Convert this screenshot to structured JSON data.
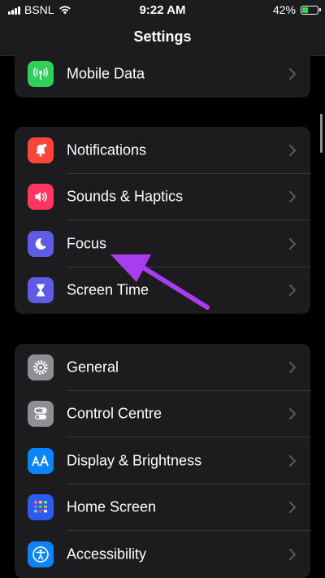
{
  "status_bar": {
    "carrier": "BSNL",
    "time": "9:22 AM",
    "battery": "42%",
    "battery_level": 0.42
  },
  "nav": {
    "title": "Settings"
  },
  "groups": [
    {
      "items": [
        {
          "label": "Mobile Data",
          "icon": "antenna-icon",
          "color": "#30d158"
        }
      ]
    },
    {
      "items": [
        {
          "label": "Notifications",
          "icon": "bell-icon",
          "color": "#ff453a"
        },
        {
          "label": "Sounds & Haptics",
          "icon": "speaker-icon",
          "color": "#ff375f"
        },
        {
          "label": "Focus",
          "icon": "moon-icon",
          "color": "#5e5ce6"
        },
        {
          "label": "Screen Time",
          "icon": "hourglass-icon",
          "color": "#5e5ce6"
        }
      ]
    },
    {
      "items": [
        {
          "label": "General",
          "icon": "gear-icon",
          "color": "#8e8e93"
        },
        {
          "label": "Control Centre",
          "icon": "toggles-icon",
          "color": "#8e8e93"
        },
        {
          "label": "Display & Brightness",
          "icon": "text-size-icon",
          "color": "#0a84ff"
        },
        {
          "label": "Home Screen",
          "icon": "app-grid-icon",
          "color": "#2c5bf0"
        },
        {
          "label": "Accessibility",
          "icon": "accessibility-icon",
          "color": "#0a84ff"
        }
      ]
    }
  ],
  "annotation": {
    "arrow_color": "#a93bf0",
    "target": "Focus"
  }
}
